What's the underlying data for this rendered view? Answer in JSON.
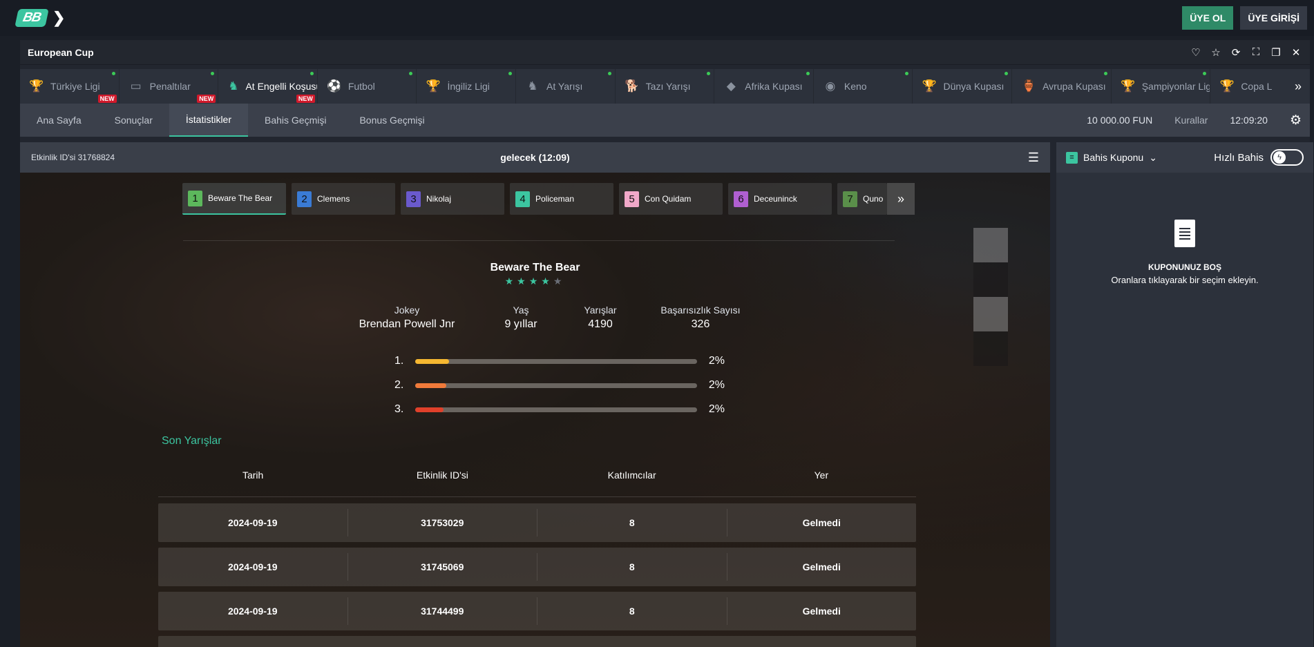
{
  "header": {
    "logo": "BB",
    "signup_label": "ÜYE OL",
    "login_label": "ÜYE GİRİŞİ"
  },
  "window": {
    "title": "European Cup"
  },
  "games": [
    {
      "label": "Türkiye Ligi",
      "icon": "trophy-icon",
      "new": true,
      "dot": true
    },
    {
      "label": "Penaltılar",
      "icon": "goal-icon",
      "new": true,
      "dot": true
    },
    {
      "label": "At Engelli Koşusu",
      "icon": "horse-jump-icon",
      "new": true,
      "dot": true,
      "active": true
    },
    {
      "label": "Futbol",
      "icon": "football-icon",
      "new": false,
      "dot": true
    },
    {
      "label": "İngiliz Ligi",
      "icon": "trophy-icon",
      "new": false,
      "dot": true
    },
    {
      "label": "At Yarışı",
      "icon": "horse-icon",
      "new": false,
      "dot": true
    },
    {
      "label": "Tazı Yarışı",
      "icon": "greyhound-icon",
      "new": false,
      "dot": true
    },
    {
      "label": "Afrika Kupası",
      "icon": "africa-icon",
      "new": false,
      "dot": true
    },
    {
      "label": "Keno",
      "icon": "keno-icon",
      "new": false,
      "dot": true
    },
    {
      "label": "Dünya Kupası",
      "icon": "world-cup-icon",
      "new": false,
      "dot": true
    },
    {
      "label": "Avrupa Kupası",
      "icon": "cup-icon",
      "new": false,
      "dot": true
    },
    {
      "label": "Şampiyonlar Ligi",
      "icon": "champions-icon",
      "new": false,
      "dot": true
    },
    {
      "label": "Copa L",
      "icon": "copa-icon",
      "new": false,
      "dot": false
    }
  ],
  "new_badge": "NEW",
  "subnav": {
    "tabs": [
      {
        "label": "Ana Sayfa"
      },
      {
        "label": "Sonuçlar"
      },
      {
        "label": "İstatistikler",
        "active": true
      },
      {
        "label": "Bahis Geçmişi"
      },
      {
        "label": "Bonus Geçmişi"
      }
    ],
    "balance": "10 000.00 FUN",
    "rules": "Kurallar",
    "clock": "12:09:20"
  },
  "event": {
    "id_label": "Etkinlik ID'si 31768824",
    "time_label": "gelecek (12:09)"
  },
  "runners": [
    {
      "num": "1",
      "name": "Beware The Bear",
      "color": "#5cb85c"
    },
    {
      "num": "2",
      "name": "Clemens",
      "color": "#3a7bd5"
    },
    {
      "num": "3",
      "name": "Nikolaj",
      "color": "#6a5acd"
    },
    {
      "num": "4",
      "name": "Policeman",
      "color": "#3cc5a0"
    },
    {
      "num": "5",
      "name": "Con Quidam",
      "color": "#f0a8c8"
    },
    {
      "num": "6",
      "name": "Deceuninck",
      "color": "#b05fd1"
    },
    {
      "num": "7",
      "name": "Quno",
      "color": "#5a8f4a"
    }
  ],
  "selected_horse": {
    "name": "Beware The Bear",
    "rating": 3.5,
    "stats": [
      {
        "label": "Jokey",
        "value": "Brendan Powell Jnr"
      },
      {
        "label": "Yaş",
        "value": "9 yıllar"
      },
      {
        "label": "Yarışlar",
        "value": "4190"
      },
      {
        "label": "Başarısızlık Sayısı",
        "value": "326"
      }
    ],
    "positions": [
      {
        "label": "1.",
        "pct": "2%",
        "fraction": 0.12,
        "color": "#f5b731"
      },
      {
        "label": "2.",
        "pct": "2%",
        "fraction": 0.11,
        "color": "#f07a3a"
      },
      {
        "label": "3.",
        "pct": "2%",
        "fraction": 0.1,
        "color": "#e0402a"
      }
    ]
  },
  "last_races": {
    "title": "Son Yarışlar",
    "columns": [
      "Tarih",
      "Etkinlik ID'si",
      "Katılımcılar",
      "Yer"
    ],
    "rows": [
      [
        "2024-09-19",
        "31753029",
        "8",
        "Gelmedi"
      ],
      [
        "2024-09-19",
        "31745069",
        "8",
        "Gelmedi"
      ],
      [
        "2024-09-19",
        "31744499",
        "8",
        "Gelmedi"
      ]
    ]
  },
  "coupon": {
    "title": "Bahis Kuponu",
    "fast_bet": "Hızlı Bahis",
    "empty_title": "KUPONUNUZ BOŞ",
    "empty_sub": "Oranlara tıklayarak bir seçim ekleyin."
  }
}
